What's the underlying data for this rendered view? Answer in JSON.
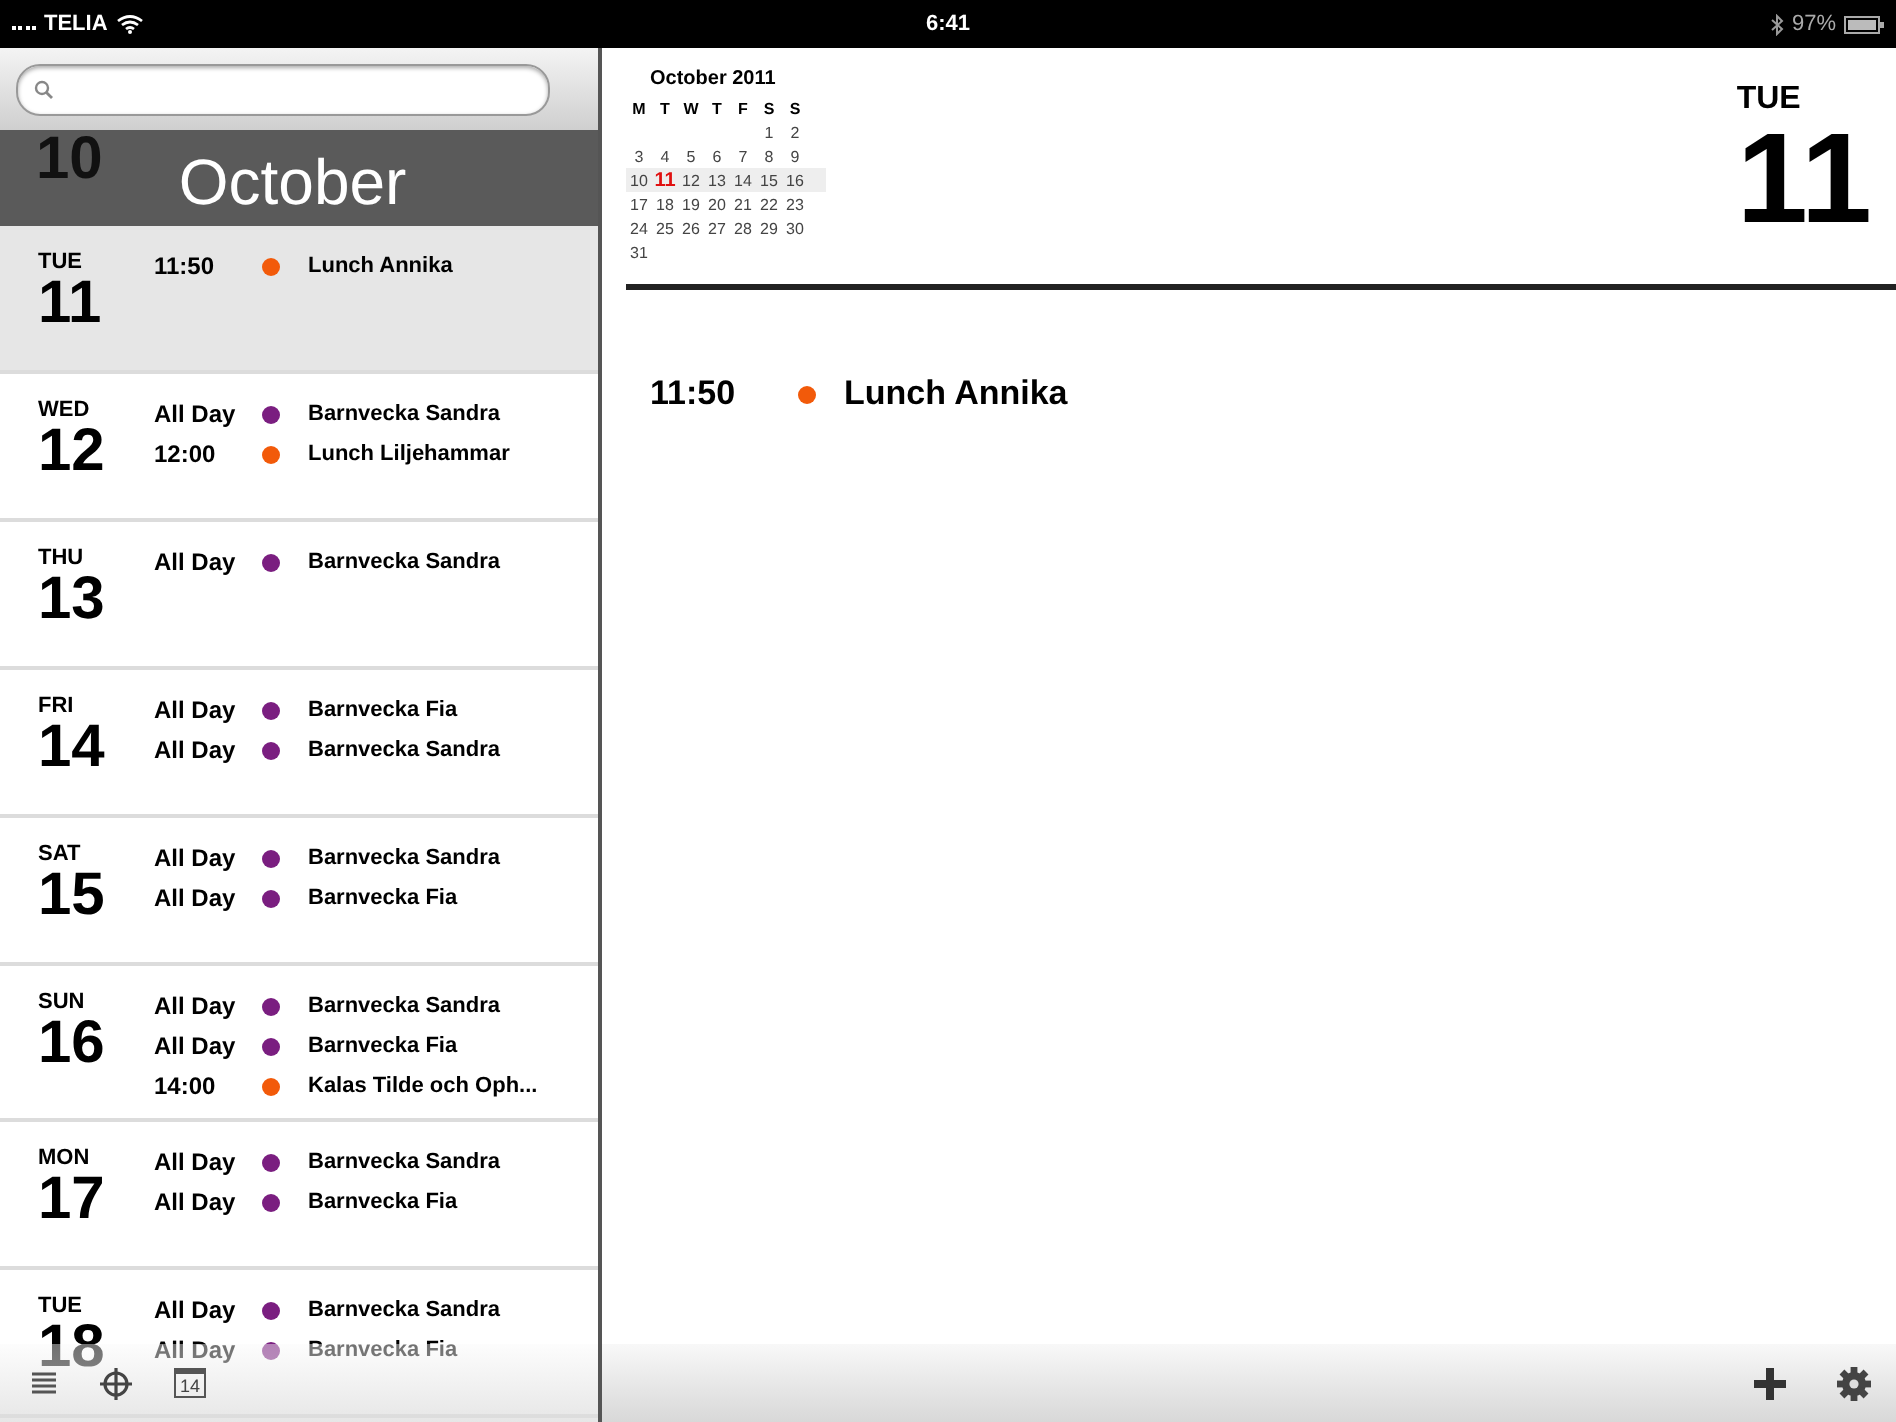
{
  "status_bar": {
    "carrier": "TELIA",
    "time": "6:41",
    "battery": "97%"
  },
  "list": {
    "month_header": {
      "partial_day": "10",
      "month": "October"
    },
    "days": [
      {
        "weekday": "TUE",
        "day": "11",
        "selected": true,
        "events": [
          {
            "time": "11:50",
            "title": "Lunch Annika",
            "color": "#f25a0a"
          }
        ]
      },
      {
        "weekday": "WED",
        "day": "12",
        "selected": false,
        "events": [
          {
            "time": "All Day",
            "title": "Barnvecka Sandra",
            "color": "#7a1e80"
          },
          {
            "time": "12:00",
            "title": "Lunch Liljehammar",
            "color": "#f25a0a"
          }
        ]
      },
      {
        "weekday": "THU",
        "day": "13",
        "selected": false,
        "events": [
          {
            "time": "All Day",
            "title": "Barnvecka Sandra",
            "color": "#7a1e80"
          }
        ]
      },
      {
        "weekday": "FRI",
        "day": "14",
        "selected": false,
        "events": [
          {
            "time": "All Day",
            "title": "Barnvecka Fia",
            "color": "#7a1e80"
          },
          {
            "time": "All Day",
            "title": "Barnvecka Sandra",
            "color": "#7a1e80"
          }
        ]
      },
      {
        "weekday": "SAT",
        "day": "15",
        "selected": false,
        "events": [
          {
            "time": "All Day",
            "title": "Barnvecka Sandra",
            "color": "#7a1e80"
          },
          {
            "time": "All Day",
            "title": "Barnvecka Fia",
            "color": "#7a1e80"
          }
        ]
      },
      {
        "weekday": "SUN",
        "day": "16",
        "selected": false,
        "events": [
          {
            "time": "All Day",
            "title": "Barnvecka Sandra",
            "color": "#7a1e80"
          },
          {
            "time": "All Day",
            "title": "Barnvecka Fia",
            "color": "#7a1e80"
          },
          {
            "time": "14:00",
            "title": "Kalas Tilde och Oph...",
            "color": "#f25a0a"
          }
        ]
      },
      {
        "weekday": "MON",
        "day": "17",
        "selected": false,
        "events": [
          {
            "time": "All Day",
            "title": "Barnvecka Sandra",
            "color": "#7a1e80"
          },
          {
            "time": "All Day",
            "title": "Barnvecka Fia",
            "color": "#7a1e80"
          }
        ]
      },
      {
        "weekday": "TUE",
        "day": "18",
        "selected": false,
        "events": [
          {
            "time": "All Day",
            "title": "Barnvecka Sandra",
            "color": "#7a1e80"
          },
          {
            "time": "All Day",
            "title": "Barnvecka Fia",
            "color": "#7a1e80"
          }
        ]
      }
    ]
  },
  "left_toolbar": {
    "calendar_icon_day": "14"
  },
  "mini_calendar": {
    "title": "October 2011",
    "weekdays": [
      "M",
      "T",
      "W",
      "T",
      "F",
      "S",
      "S"
    ],
    "weeks": [
      {
        "current": false,
        "days": [
          {
            "label": "1",
            "selected": false
          },
          {
            "label": "2",
            "selected": false
          }
        ]
      },
      {
        "current": false,
        "days": [
          {
            "label": "3",
            "selected": false
          },
          {
            "label": "4",
            "selected": false
          },
          {
            "label": "5",
            "selected": false
          },
          {
            "label": "6",
            "selected": false
          },
          {
            "label": "7",
            "selected": false
          },
          {
            "label": "8",
            "selected": false
          },
          {
            "label": "9",
            "selected": false
          }
        ]
      },
      {
        "current": true,
        "days": [
          {
            "label": "10",
            "selected": false
          },
          {
            "label": "11",
            "selected": true
          },
          {
            "label": "12",
            "selected": false
          },
          {
            "label": "13",
            "selected": false
          },
          {
            "label": "14",
            "selected": false
          },
          {
            "label": "15",
            "selected": false
          },
          {
            "label": "16",
            "selected": false
          }
        ]
      },
      {
        "current": false,
        "days": [
          {
            "label": "17",
            "selected": false
          },
          {
            "label": "18",
            "selected": false
          },
          {
            "label": "19",
            "selected": false
          },
          {
            "label": "20",
            "selected": false
          },
          {
            "label": "21",
            "selected": false
          },
          {
            "label": "22",
            "selected": false
          },
          {
            "label": "23",
            "selected": false
          }
        ]
      },
      {
        "current": false,
        "days": [
          {
            "label": "24",
            "selected": false
          },
          {
            "label": "25",
            "selected": false
          },
          {
            "label": "26",
            "selected": false
          },
          {
            "label": "27",
            "selected": false
          },
          {
            "label": "28",
            "selected": false
          },
          {
            "label": "29",
            "selected": false
          },
          {
            "label": "30",
            "selected": false
          }
        ]
      },
      {
        "current": false,
        "days": [
          {
            "label": "31",
            "selected": false
          }
        ]
      }
    ]
  },
  "detail": {
    "weekday": "TUE",
    "day": "11",
    "events": [
      {
        "time": "11:50",
        "title": "Lunch Annika",
        "color": "#f25a0a"
      }
    ]
  }
}
